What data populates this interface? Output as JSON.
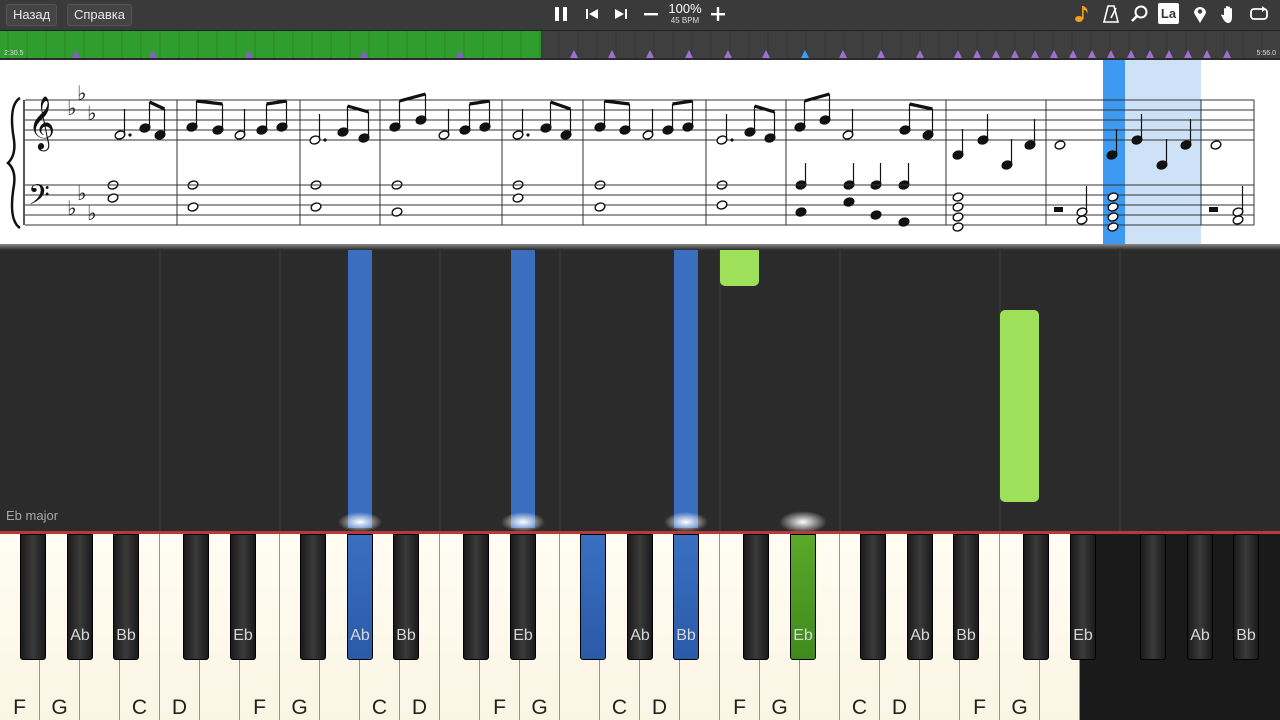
{
  "toolbar": {
    "back_label": "Назад",
    "help_label": "Справка",
    "zoom": "100%",
    "bpm": "45 BPM",
    "icons": [
      "pause-icon",
      "skip-back-icon",
      "skip-forward-icon",
      "minus-icon",
      "plus-icon",
      "note-icon",
      "metronome-icon",
      "magnifier-icon",
      "la-icon",
      "location-pin-icon",
      "hand-icon",
      "loop-icon"
    ],
    "la_text": "La"
  },
  "timeline": {
    "start_time": "2:30.5",
    "end_time": "5:56.0",
    "progress": 0.423,
    "accent_green": "#2f9e2f",
    "marker_color": "#a070d0"
  },
  "sheet": {
    "key_signature": "Eb major"
  },
  "keyboard": {
    "white_labels": [
      "F",
      "G",
      "",
      "C",
      "D",
      "",
      "F",
      "G",
      "",
      "C",
      "D",
      "",
      "F",
      "G",
      "",
      "C",
      "D",
      "",
      "F",
      "G",
      "",
      "C",
      "D",
      "",
      "F",
      "G",
      ""
    ],
    "black_labels": [
      "",
      "Ab",
      "Bb",
      "",
      "Eb",
      "",
      "Ab",
      "Bb",
      "",
      "Eb",
      "",
      "Ab",
      "Bb",
      "",
      "Eb",
      "",
      "Ab",
      "Bb",
      "",
      "Eb",
      "",
      "Ab",
      "Bb"
    ],
    "colors": {
      "left_hand": "#3a6fc0",
      "right_hand": "#9ee05a"
    }
  }
}
